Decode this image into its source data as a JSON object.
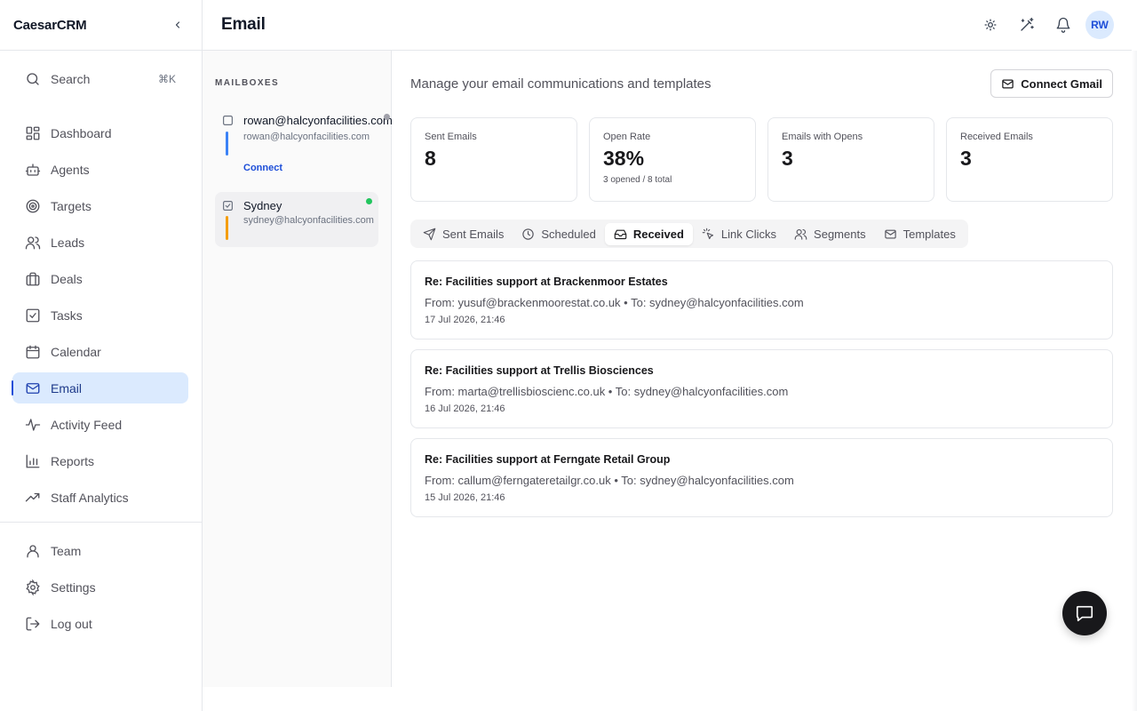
{
  "sidebar": {
    "brand": "CaesarCRM",
    "search": {
      "label": "Search",
      "shortcut": "⌘K"
    },
    "items": [
      {
        "label": "Dashboard",
        "icon": "dashboard-icon"
      },
      {
        "label": "Agents",
        "icon": "bot-icon"
      },
      {
        "label": "Targets",
        "icon": "target-icon"
      },
      {
        "label": "Leads",
        "icon": "users-icon"
      },
      {
        "label": "Deals",
        "icon": "briefcase-icon"
      },
      {
        "label": "Tasks",
        "icon": "checkbox-icon"
      },
      {
        "label": "Calendar",
        "icon": "calendar-icon"
      },
      {
        "label": "Email",
        "icon": "mail-icon",
        "active": true
      },
      {
        "label": "Activity Feed",
        "icon": "activity-icon"
      },
      {
        "label": "Reports",
        "icon": "bar-chart-icon"
      },
      {
        "label": "Staff Analytics",
        "icon": "trending-up-icon"
      }
    ],
    "bottom_items": [
      {
        "label": "Team",
        "icon": "user-icon"
      },
      {
        "label": "Settings",
        "icon": "gear-icon"
      },
      {
        "label": "Log out",
        "icon": "logout-icon"
      }
    ]
  },
  "header": {
    "title": "Email",
    "avatar_initials": "RW"
  },
  "mailboxes": {
    "heading": "MAILBOXES",
    "items": [
      {
        "name": "rowan@halcyonfacilities.com",
        "address": "rowan@halcyonfacilities.com",
        "action": "Connect",
        "bar_color": "#3b82f6",
        "dot_color": "#a1a1aa",
        "checked": false
      },
      {
        "name": "Sydney",
        "address": "sydney@halcyonfacilities.com",
        "bar_color": "#f59e0b",
        "dot_color": "#22c55e",
        "checked": true
      }
    ]
  },
  "main": {
    "subtitle": "Manage your email communications and templates",
    "connect_button": "Connect Gmail",
    "stats": [
      {
        "label": "Sent Emails",
        "value": "8",
        "sub": ""
      },
      {
        "label": "Open Rate",
        "value": "38%",
        "sub": "3 opened / 8 total"
      },
      {
        "label": "Emails with Opens",
        "value": "3",
        "sub": ""
      },
      {
        "label": "Received Emails",
        "value": "3",
        "sub": ""
      }
    ],
    "tabs": [
      {
        "label": "Sent Emails",
        "icon": "send-icon"
      },
      {
        "label": "Scheduled",
        "icon": "clock-icon"
      },
      {
        "label": "Received",
        "icon": "inbox-icon",
        "active": true
      },
      {
        "label": "Link Clicks",
        "icon": "cursor-click-icon"
      },
      {
        "label": "Segments",
        "icon": "users-icon"
      },
      {
        "label": "Templates",
        "icon": "mail-icon"
      }
    ],
    "emails": [
      {
        "subject": "Re: Facilities support at Brackenmoor Estates",
        "meta": "From: yusuf@brackenmoorestat.co.uk • To: sydney@halcyonfacilities.com",
        "time": "17 Jul 2026, 21:46"
      },
      {
        "subject": "Re: Facilities support at Trellis Biosciences",
        "meta": "From: marta@trellisbioscienc.co.uk • To: sydney@halcyonfacilities.com",
        "time": "16 Jul 2026, 21:46"
      },
      {
        "subject": "Re: Facilities support at Ferngate Retail Group",
        "meta": "From: callum@ferngateretailgr.co.uk • To: sydney@halcyonfacilities.com",
        "time": "15 Jul 2026, 21:46"
      }
    ]
  },
  "colors": {
    "accent": "#1d4ed8",
    "active_bg": "#dbeafe",
    "fab": "#18181b"
  }
}
